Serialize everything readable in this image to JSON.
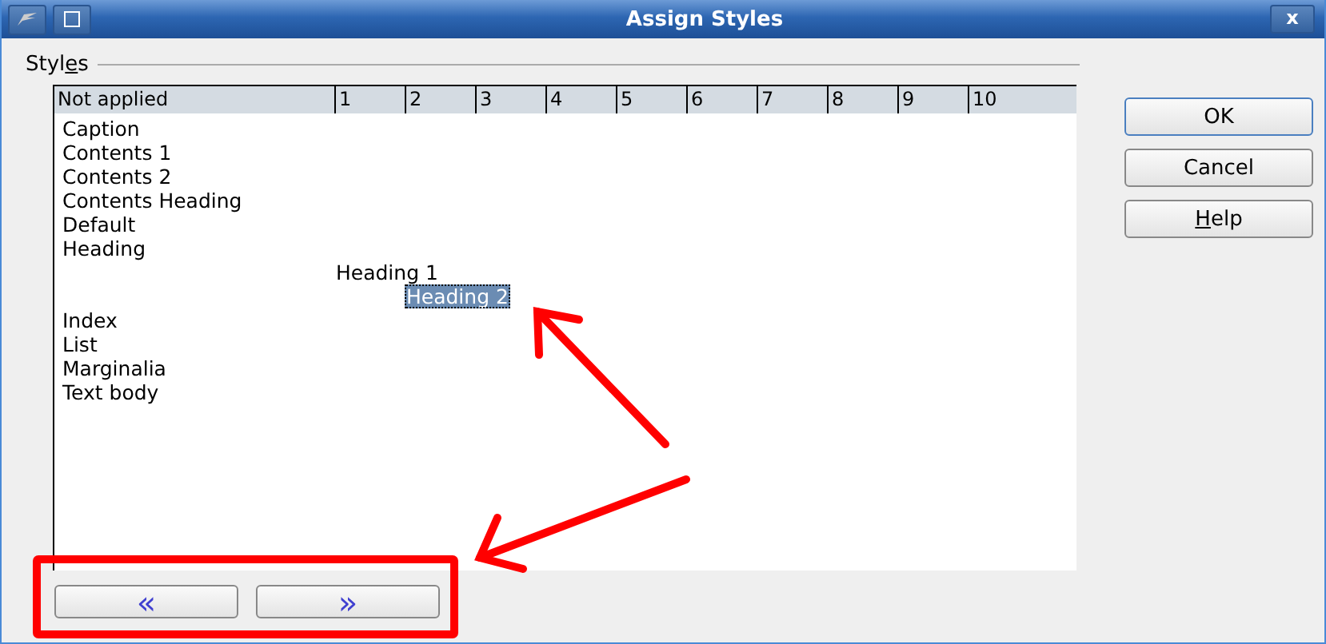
{
  "window": {
    "title": "Assign Styles",
    "close": "x"
  },
  "styles_group": {
    "label": "Styl",
    "label_mnemonic": "e",
    "label_rest": "s"
  },
  "table": {
    "columns": [
      "Not applied",
      "1",
      "2",
      "3",
      "4",
      "5",
      "6",
      "7",
      "8",
      "9",
      "10"
    ],
    "rows": [
      {
        "label": "Caption",
        "selected": false
      },
      {
        "label": "Contents 1",
        "selected": false
      },
      {
        "label": "Contents 2",
        "selected": false
      },
      {
        "label": "Contents Heading",
        "selected": false
      },
      {
        "label": "Default",
        "selected": false
      },
      {
        "label": "Heading",
        "selected": false,
        "children": [
          {
            "label": "Heading 1",
            "selected": false,
            "children": [
              {
                "label": "Heading 2",
                "selected": true
              }
            ]
          }
        ]
      },
      {
        "label": "Index",
        "selected": false
      },
      {
        "label": "List",
        "selected": false
      },
      {
        "label": "Marginalia",
        "selected": false
      },
      {
        "label": "Text body",
        "selected": false
      }
    ]
  },
  "move_buttons": [
    "«",
    "»"
  ],
  "buttons": [
    {
      "label": "OK",
      "default": true
    },
    {
      "label": "Cancel",
      "default": false
    },
    {
      "mnemonic": "H",
      "rest": "elp",
      "default": false
    }
  ],
  "annotations": [
    {
      "kind": "arrow"
    },
    {
      "kind": "arrow"
    },
    {
      "kind": "frame"
    }
  ]
}
